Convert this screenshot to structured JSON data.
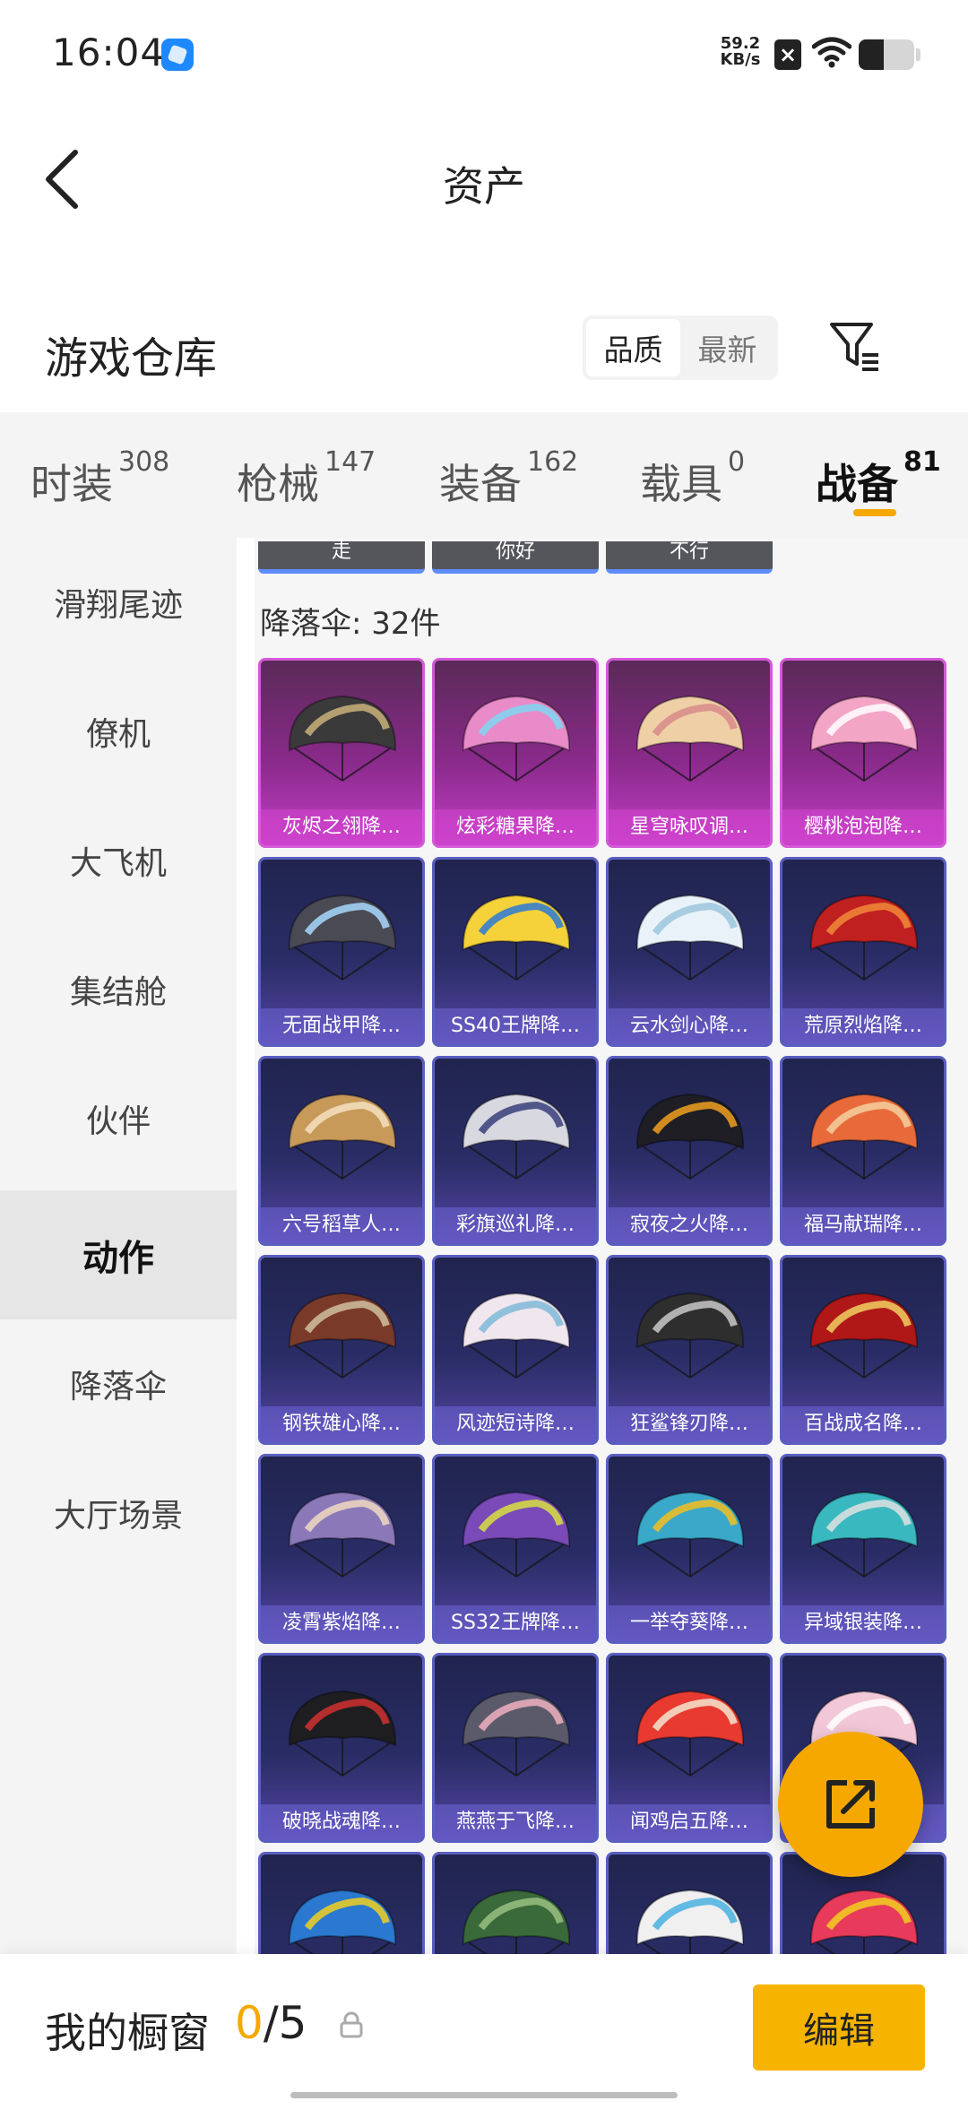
{
  "status_bar": {
    "time": "16:04",
    "net_speed_value": "59.2",
    "net_speed_unit": "KB/s",
    "sim_icon_text": "×",
    "battery_level": 0.45
  },
  "header": {
    "title": "资产"
  },
  "warehouse": {
    "title": "游戏仓库",
    "sort_options": [
      {
        "label": "品质",
        "selected": true
      },
      {
        "label": "最新",
        "selected": false
      }
    ]
  },
  "tabs": [
    {
      "label": "时装",
      "count": "308",
      "active": false
    },
    {
      "label": "枪械",
      "count": "147",
      "active": false
    },
    {
      "label": "装备",
      "count": "162",
      "active": false
    },
    {
      "label": "载具",
      "count": "0",
      "active": false
    },
    {
      "label": "战备",
      "count": "81",
      "active": true
    }
  ],
  "sidebar": {
    "items": [
      {
        "label": "滑翔尾迹",
        "active": false
      },
      {
        "label": "僚机",
        "active": false
      },
      {
        "label": "大飞机",
        "active": false
      },
      {
        "label": "集结舱",
        "active": false
      },
      {
        "label": "伙伴",
        "active": false
      },
      {
        "label": "动作",
        "active": true
      },
      {
        "label": "降落伞",
        "active": false
      },
      {
        "label": "大厅场景",
        "active": false
      }
    ]
  },
  "content": {
    "chips": [
      "走",
      "你好",
      "不行"
    ],
    "section_label": "降落伞: 32件",
    "cards": [
      {
        "name": "灰烬之翎降…",
        "rarity": "legend",
        "color": "#3a3a3a",
        "accent": "#c9b27a"
      },
      {
        "name": "炫彩糖果降…",
        "rarity": "legend",
        "color": "#e88bc8",
        "accent": "#7fd6f0"
      },
      {
        "name": "星穹咏叹调…",
        "rarity": "legend",
        "color": "#efcfa6",
        "accent": "#d88a8a"
      },
      {
        "name": "樱桃泡泡降…",
        "rarity": "legend",
        "color": "#f3a5c6",
        "accent": "#ffffff"
      },
      {
        "name": "无面战甲降…",
        "rarity": "epic",
        "color": "#4a4a55",
        "accent": "#a7d8ff"
      },
      {
        "name": "SS40王牌降…",
        "rarity": "epic",
        "color": "#f5d23a",
        "accent": "#2a7ad6"
      },
      {
        "name": "云水剑心降…",
        "rarity": "epic",
        "color": "#e8f2f8",
        "accent": "#9cc6dd"
      },
      {
        "name": "荒原烈焰降…",
        "rarity": "epic",
        "color": "#c12020",
        "accent": "#f08a3a"
      },
      {
        "name": "六号稻草人…",
        "rarity": "epic",
        "color": "#c79a5a",
        "accent": "#f3e0c0"
      },
      {
        "name": "彩旗巡礼降…",
        "rarity": "epic",
        "color": "#d8d8e0",
        "accent": "#3a3f7a"
      },
      {
        "name": "寂夜之火降…",
        "rarity": "epic",
        "color": "#1e1e24",
        "accent": "#f0a020"
      },
      {
        "name": "福马献瑞降…",
        "rarity": "epic",
        "color": "#e86a3a",
        "accent": "#f5d0a0"
      },
      {
        "name": "钢铁雄心降…",
        "rarity": "epic",
        "color": "#7a3a2a",
        "accent": "#d0c0a0"
      },
      {
        "name": "风迹短诗降…",
        "rarity": "epic",
        "color": "#f0e6ee",
        "accent": "#7fb8d8"
      },
      {
        "name": "狂鲨锋刃降…",
        "rarity": "epic",
        "color": "#2e2e2e",
        "accent": "#c8c8c8"
      },
      {
        "name": "百战成名降…",
        "rarity": "epic",
        "color": "#b01818",
        "accent": "#f0d060"
      },
      {
        "name": "凌霄紫焰降…",
        "rarity": "epic",
        "color": "#8a78b8",
        "accent": "#f0d8c0"
      },
      {
        "name": "SS32王牌降…",
        "rarity": "epic",
        "color": "#7a4ab8",
        "accent": "#d8e040"
      },
      {
        "name": "一举夺葵降…",
        "rarity": "epic",
        "color": "#3aa8c8",
        "accent": "#f5c020"
      },
      {
        "name": "异域银装降…",
        "rarity": "epic",
        "color": "#3ab8c0",
        "accent": "#e0e0e0"
      },
      {
        "name": "破晓战魂降…",
        "rarity": "epic",
        "color": "#1e1e20",
        "accent": "#d03030"
      },
      {
        "name": "燕燕于飞降…",
        "rarity": "epic",
        "color": "#5a5a6a",
        "accent": "#f0b0c0"
      },
      {
        "name": "闻鸡启五降…",
        "rarity": "epic",
        "color": "#e83a30",
        "accent": "#f5e6d0"
      },
      {
        "name": "",
        "rarity": "epic",
        "color": "#f2c8d8",
        "accent": "#ffffff"
      },
      {
        "name": "",
        "rarity": "epic",
        "color": "#2a78d0",
        "accent": "#f0d020"
      },
      {
        "name": "",
        "rarity": "epic",
        "color": "#3a6a3a",
        "accent": "#9ac080"
      },
      {
        "name": "",
        "rarity": "epic",
        "color": "#f0f0f0",
        "accent": "#4ab0e0"
      },
      {
        "name": "",
        "rarity": "epic",
        "color": "#e83a5a",
        "accent": "#f0d020"
      }
    ]
  },
  "fab": {
    "icon": "share-external-icon"
  },
  "bottom_bar": {
    "label": "我的橱窗",
    "current": "0",
    "separator_total": "/5",
    "edit_label": "编辑"
  },
  "colors": {
    "accent": "#f5a800",
    "legend_border": "#d45ad8",
    "epic_border": "#5a5ec0"
  }
}
